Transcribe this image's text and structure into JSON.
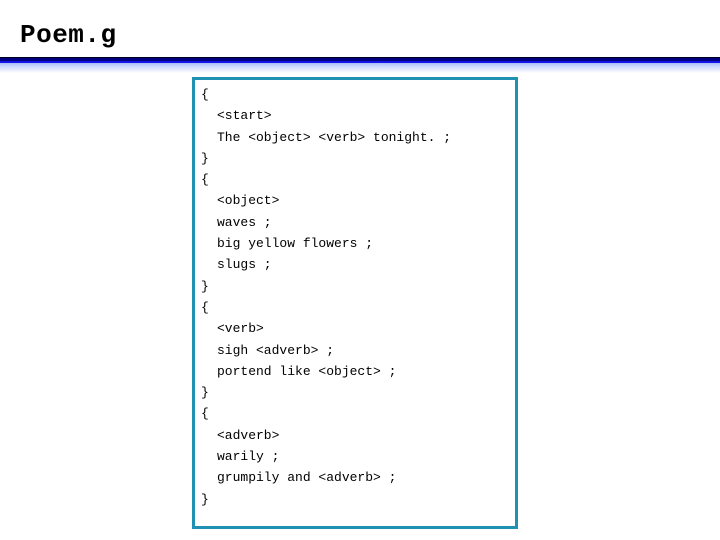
{
  "slide": {
    "title": "Poem.g"
  },
  "code_box": {
    "border_color": "#1f91b3",
    "lines": [
      {
        "text": "{",
        "indent": false
      },
      {
        "text": "<start>",
        "indent": true
      },
      {
        "text": "The <object> <verb> tonight. ;",
        "indent": true
      },
      {
        "text": "}",
        "indent": false
      },
      {
        "text": "{",
        "indent": false
      },
      {
        "text": "<object>",
        "indent": true
      },
      {
        "text": "waves ;",
        "indent": true
      },
      {
        "text": "big yellow flowers ;",
        "indent": true
      },
      {
        "text": "slugs ;",
        "indent": true
      },
      {
        "text": "}",
        "indent": false
      },
      {
        "text": "{",
        "indent": false
      },
      {
        "text": "<verb>",
        "indent": true
      },
      {
        "text": "sigh <adverb> ;",
        "indent": true
      },
      {
        "text": "portend like <object> ;",
        "indent": true
      },
      {
        "text": "}",
        "indent": false
      },
      {
        "text": "{",
        "indent": false
      },
      {
        "text": "<adverb>",
        "indent": true
      },
      {
        "text": "warily ;",
        "indent": true
      },
      {
        "text": "grumpily and <adverb> ;",
        "indent": true
      },
      {
        "text": "}",
        "indent": false
      }
    ]
  },
  "decoration": {
    "rule_dark_color": "#000020",
    "rule_navy_color": "#000080",
    "rule_blue_color": "#1414e6",
    "background_color": "#ffffff"
  }
}
